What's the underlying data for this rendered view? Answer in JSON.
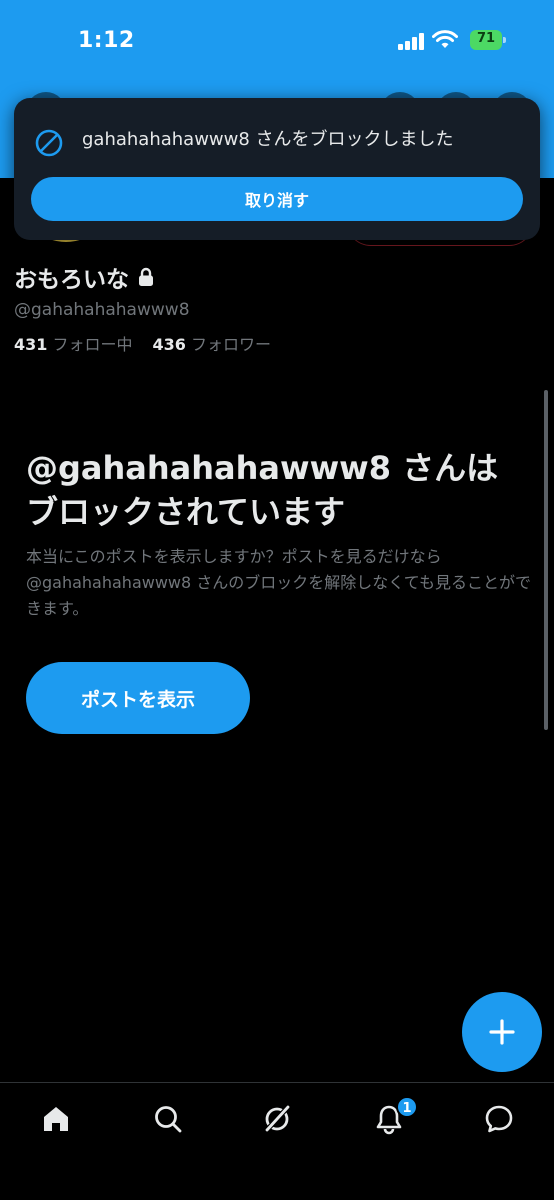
{
  "status_bar": {
    "time": "1:12",
    "battery": "71"
  },
  "toast": {
    "icon": "block-icon",
    "message": "gahahahahawww8 さんをブロックしました",
    "undo_label": "取り消す"
  },
  "profile": {
    "display_name": "おもろいな",
    "handle": "@gahahahahawww8",
    "following_count": "431",
    "following_label": "フォロー中",
    "followers_count": "436",
    "followers_label": "フォロワー"
  },
  "blocked": {
    "title": "@gahahahahawww8 さんはブロックされています",
    "description": "本当にこのポストを表示しますか？ポストを見るだけなら @gahahahahawww8 さんのブロックを解除しなくても見ることができます。",
    "show_posts_label": "ポストを表示"
  },
  "bottom_nav": {
    "items": [
      "home-icon",
      "search-icon",
      "grok-icon",
      "notifications-icon",
      "messages-icon"
    ],
    "notification_badge": "1"
  },
  "colors": {
    "accent": "#1d9bf0",
    "background": "#000000",
    "secondary_text": "#71767b"
  }
}
